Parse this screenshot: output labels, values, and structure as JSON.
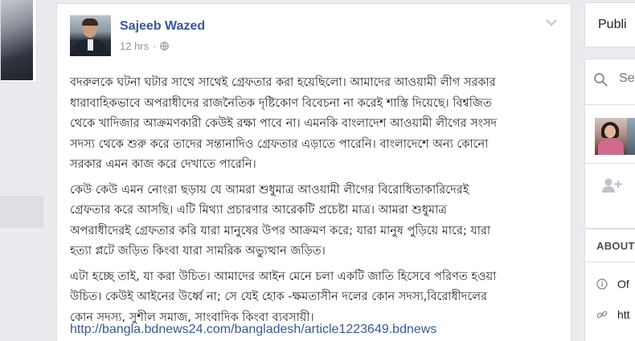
{
  "post": {
    "author": "Sajeeb Wazed",
    "timestamp": "12 hrs",
    "separator": "·",
    "privacy_icon": "globe-icon",
    "paragraphs": [
      [
        "বদরুলকে ঘটনা ঘটার সাথে সাথেই গ্রেফতার করা হয়েছিলো। আমাদের আওয়ামী লীগ সরকার",
        "ধারাবাহিকভাবে অপরাধীদের রাজনৈতিক দৃষ্টিকোণ বিবেচনা না করেই শাস্তি দিয়েছে। বিশ্বজিত",
        "থেকে খাদিজার আক্রমণকারী কেউই রক্ষা পাবে না। এমনকি বাংলাদেশ আওয়ামী লীগের সংসদ",
        "সদস্য থেকে শুরু করে তাদের সন্তানাদিও গ্রেফতার এড়াতে পারেনি। বাংলাদেশে অন্য কোনো",
        "সরকার এমন কাজ করে দেখাতে পারেনি।"
      ],
      [
        "কেউ কেউ এমন নোংরা ছড়ায় যে আমরা শুধুমাত্র আওয়ামী লীগের বিরোধিতাকারিদেরই",
        "গ্রেফতার করে আসছি। এটি মিথ্যা প্রচারণার আরেকটি প্রচেষ্টা মাত্র। আমরা শুধুমাত্র",
        "অপরাধীদেরই গ্রেফতার করি যারা মানুষের উপর আক্রমণ করে; যারা মানুষ পুড়িয়ে মারে; যারা",
        "হত্যা প্লটে জড়িত কিংবা যারা সামরিক অভ্যুত্থান জড়িত।"
      ],
      [
        "এটা হচ্ছে তাই, যা করা উচিত। আমাদের আইন মেনে চলা একটি জাতি হিসেবে পরিণত হওয়া",
        "উচিত। কেউই আইনের উর্ধ্বে না; সে যেই হোক -ক্ষমতাসীন দলের কোন সদস্য,বিরোধীদলের",
        "কোন সদস্য, সুশীল সমাজ, সাংবাদিক কিংবা ব্যবসায়ী।"
      ]
    ],
    "link": "http://bangla.bdnews24.com/bangladesh/article1223649.bdnews"
  },
  "right_column": {
    "tab_label": "Publi",
    "search_placeholder": "Se",
    "about_header": "ABOUT",
    "about_rows": [
      {
        "icon": "info-icon",
        "text": "Of"
      },
      {
        "icon": "link-icon",
        "text": "htt"
      }
    ]
  },
  "colors": {
    "link": "#365899",
    "background": "#e9ebee",
    "text": "#1d2129",
    "meta": "#90949c"
  }
}
